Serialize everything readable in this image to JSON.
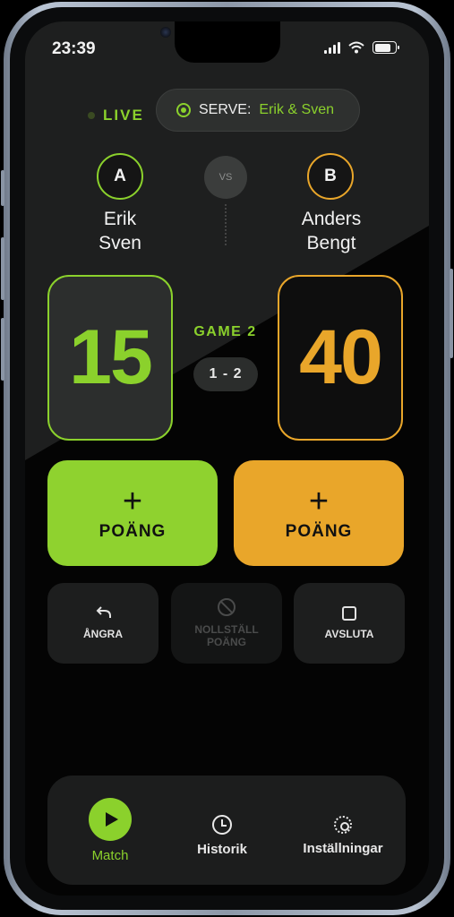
{
  "status_bar": {
    "time": "23:39"
  },
  "header": {
    "live_label": "LIVE",
    "serve_label": "SERVE:",
    "serve_team": "Erik & Sven"
  },
  "teams": {
    "a": {
      "badge": "A",
      "player1": "Erik",
      "player2": "Sven",
      "score": "15",
      "color": "#8bd12c"
    },
    "b": {
      "badge": "B",
      "player1": "Anders",
      "player2": "Bengt",
      "score": "40",
      "color": "#e9a62a"
    },
    "vs_label": "VS"
  },
  "game": {
    "label": "GAME 2",
    "score": "1 - 2"
  },
  "point_buttons": {
    "a": {
      "plus": "+",
      "label": "POÄNG"
    },
    "b": {
      "plus": "+",
      "label": "POÄNG"
    }
  },
  "actions": {
    "undo": {
      "label": "ÅNGRA",
      "icon": "undo-icon"
    },
    "reset": {
      "label_line1": "NOLLSTÄLL",
      "label_line2": "POÄNG",
      "icon": "ban-icon",
      "enabled": false
    },
    "end": {
      "label": "AVSLUTA",
      "icon": "stop-icon"
    }
  },
  "nav": {
    "items": [
      {
        "label": "Match",
        "icon": "play-icon",
        "active": true
      },
      {
        "label": "Historik",
        "icon": "clock-icon",
        "active": false
      },
      {
        "label": "Inställningar",
        "icon": "gear-icon",
        "active": false
      }
    ]
  }
}
